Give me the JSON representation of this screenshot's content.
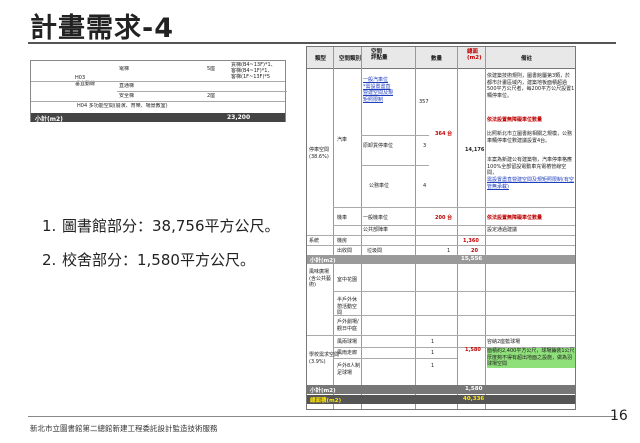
{
  "slide": {
    "title": "計畫需求-4",
    "bullets": [
      {
        "num": "1.",
        "text": "圖書館部分：38,756平方公尺。"
      },
      {
        "num": "2.",
        "text": "校舍部分：1,580平方公尺。"
      }
    ],
    "footer": "新北市立圖書館第二總館新建工程委託設計監造技術服務",
    "page_number": "16"
  },
  "left_table": {
    "group_label": "H03\n垂直動線",
    "rows": [
      {
        "name": "電梯",
        "qty": "5座",
        "note": "貨梯(B4~13F)*1、\n客梯(B4~1F)*1、\n客梯(1F~13F)*5"
      },
      {
        "name": "直通梯",
        "qty": "",
        "note": ""
      },
      {
        "name": "安全梯",
        "qty": "2座",
        "note": ""
      }
    ],
    "h04_label": "H04 多功能空間(展演、育樂、場景教室)",
    "total_label": "小計(m2)",
    "total_value": "23,200"
  },
  "right_table": {
    "headers": [
      "類型",
      "空間類別",
      "空間\n評點量",
      "數量",
      "總面\n(m2)",
      "備註"
    ],
    "parking": {
      "group": "停車空間\n(38.6%)",
      "sub": "汽車",
      "item1_name": "一般汽車位\n*需設置盡直\n營建空間及規\n矩照限制",
      "item1_qty": "357",
      "item1_sum": "364 台",
      "item2_name": "原卸貨停車位",
      "item2_qty": "3",
      "item3_name": "公務車位",
      "item3_qty": "4",
      "area": "14,176",
      "note1": "依建築技術規則，圖書館屬第3類，於都市計畫區域內，建築地板面積超過500平方公尺者，每200平方公尺設置1輛停車位。",
      "note1_red": "依法設置無障礙車位數量",
      "note2": "比照新北市立圖書館相關之規模，公務車輛停車位數建議設置4台。",
      "note3": "本案為新建公有建築物，汽車停車格應100%全部留設電動車充電樁管線空間，",
      "note3_blue": "需設置盡直營建空間及規矩照限制(有空管無承載)",
      "moto_name": "機車",
      "moto_item": "一般機車位",
      "moto_sum": "200 台",
      "moto_note_red": "依法設置無障礙車位數量",
      "public_label": "公共部陣車",
      "public_note": "設定通過建議"
    },
    "row_system": {
      "group": "系統",
      "name": "機房",
      "sum": "1,360"
    },
    "row_other": {
      "group": "",
      "name": "出收間",
      "item": "垃圾間",
      "qty": "1",
      "sum": "20"
    },
    "subtotal1_label": "小計(m2)",
    "subtotal1_value": "15,556",
    "school": {
      "group1": "風味廣場(含公共藝術)",
      "item_a": "室中花園",
      "item_b": "半戶外休憩活動空間",
      "item_c": "戶外劇場/觀日中庭",
      "group2": "學校需求空間\n(3.9%)",
      "item_d": "風兩球場",
      "item_e": "風雨走廊",
      "item_f": "戶外8人制足球場",
      "qty_d": "1",
      "qty_e": "1",
      "qty_f": "1",
      "sum": "1,580",
      "note_d": "容納2座籃球場",
      "note_green": "面積約2,400平方公尺，球場鋪裝1公尺厚度夠不得有超出地面之設施，做為羽球場空間"
    },
    "subtotal2_label": "小計(m2)",
    "subtotal2_value": "1,580",
    "total_label": "總面積(m2)",
    "total_value": "40,336"
  }
}
